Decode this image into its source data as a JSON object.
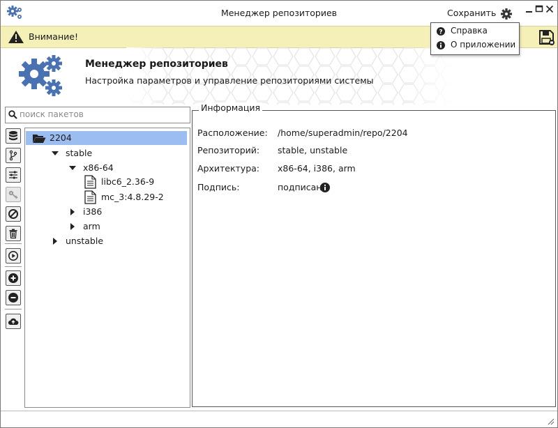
{
  "window": {
    "title": "Менеджер репозиториев",
    "save_label": "Сохранить"
  },
  "menu": {
    "items": [
      {
        "label": "Справка",
        "icon": "question-circle-icon"
      },
      {
        "label": "О приложении",
        "icon": "info-circle-icon"
      }
    ]
  },
  "warning": {
    "text": "Внимание!"
  },
  "header": {
    "title": "Менеджер репозиториев",
    "subtitle": "Настройка параметров и управление репозиториями системы"
  },
  "search": {
    "placeholder": "поиск пакетов",
    "value": ""
  },
  "toolbar": {
    "tools": [
      {
        "name": "database-icon",
        "enabled": true
      },
      {
        "name": "branch-icon",
        "enabled": true
      },
      {
        "name": "sliders-icon",
        "enabled": true
      },
      {
        "name": "key-icon",
        "enabled": false
      },
      {
        "name": "ban-icon",
        "enabled": true
      },
      {
        "name": "trash-icon",
        "enabled": true
      },
      {
        "name": "play-icon",
        "enabled": true
      },
      {
        "name": "plus-circle-icon",
        "enabled": true
      },
      {
        "name": "minus-circle-icon",
        "enabled": true
      },
      {
        "name": "cloud-upload-icon",
        "enabled": true
      }
    ]
  },
  "tree": {
    "nodes": [
      {
        "label": "2204",
        "type": "folder-open",
        "selected": true
      },
      {
        "label": "stable",
        "type": "expanded"
      },
      {
        "label": "x86-64",
        "type": "expanded"
      },
      {
        "label": "libc6_2.36-9",
        "type": "file"
      },
      {
        "label": "mc_3:4.8.29-2",
        "type": "file"
      },
      {
        "label": "i386",
        "type": "collapsed"
      },
      {
        "label": "arm",
        "type": "collapsed"
      },
      {
        "label": "unstable",
        "type": "collapsed"
      }
    ]
  },
  "info": {
    "legend": "Информация",
    "rows": [
      {
        "key": "Расположение:",
        "value": "/home/superadmin/repo/2204"
      },
      {
        "key": "Репозиторий:",
        "value": "stable, unstable"
      },
      {
        "key": "Архитектура:",
        "value": "x86-64, i386, arm"
      },
      {
        "key": "Подпись:",
        "value": "подписан"
      }
    ]
  },
  "colors": {
    "accent_blue": "#4a72b0",
    "selection": "#9bbdf0",
    "warning_bg": "#f5efb8"
  }
}
